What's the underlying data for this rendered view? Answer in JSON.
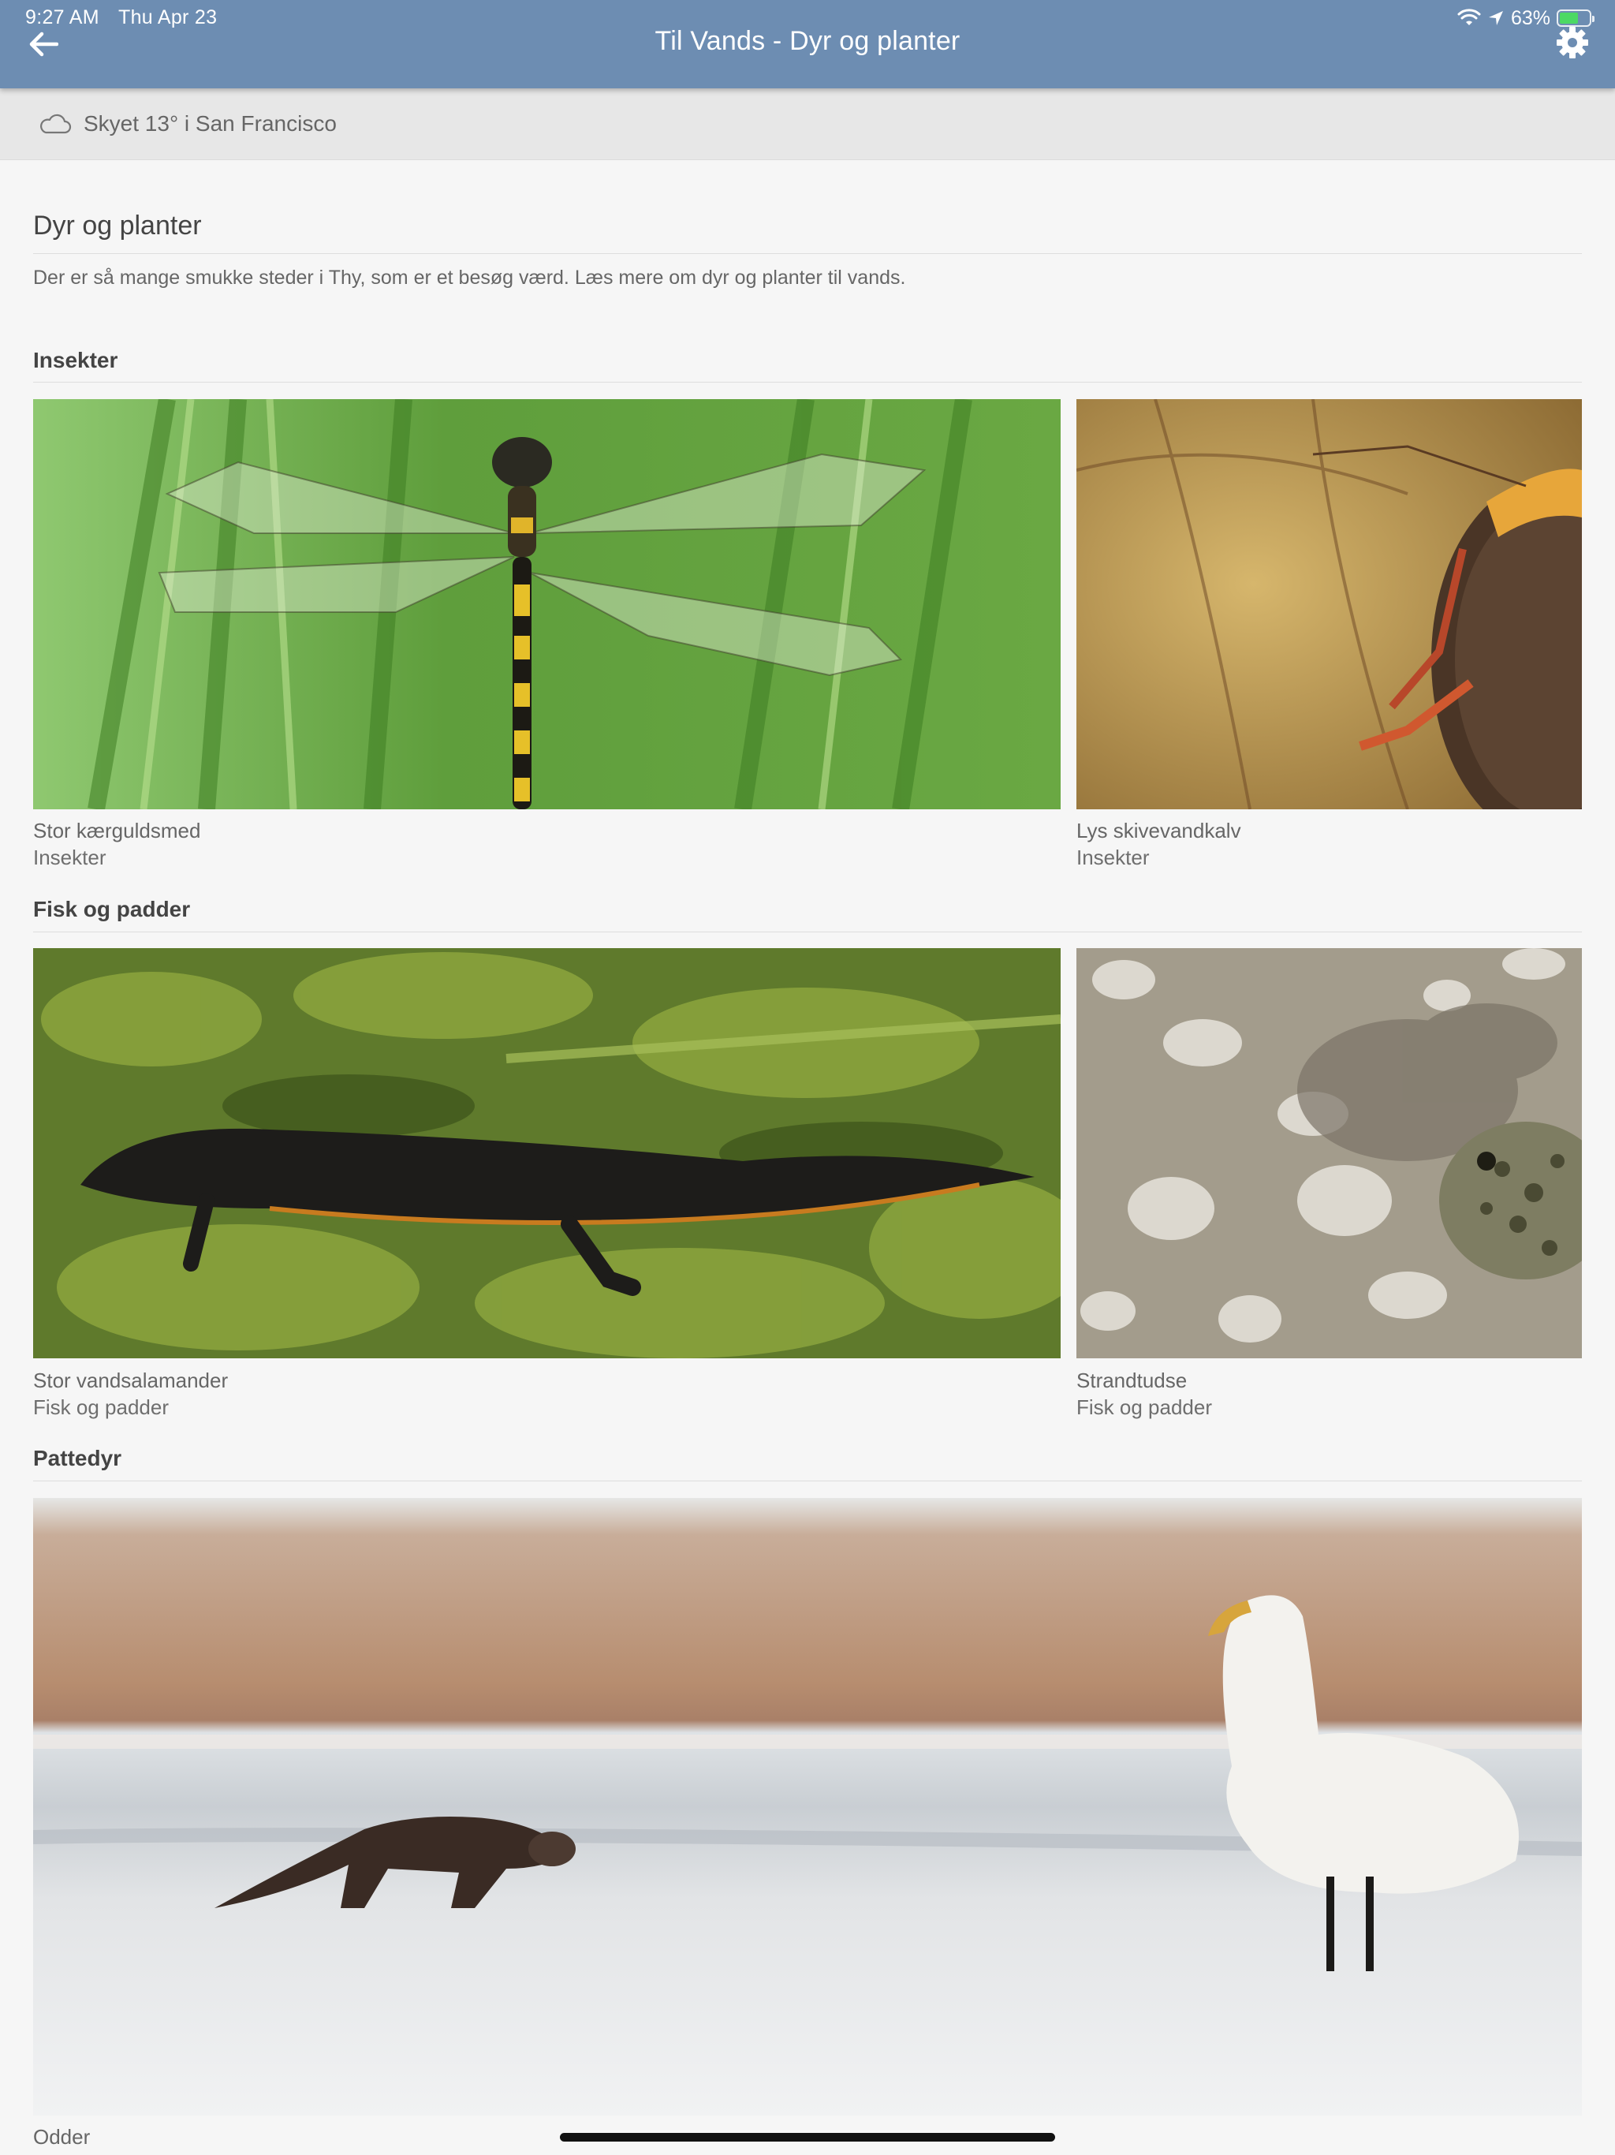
{
  "status_bar": {
    "time": "9:27 AM",
    "date": "Thu Apr 23",
    "battery": "63%",
    "battery_level": 0.63
  },
  "nav": {
    "title": "Til Vands - Dyr og planter",
    "back_icon": "arrow-left-icon",
    "settings_icon": "gear-icon"
  },
  "weather": {
    "icon": "cloud-icon",
    "text": "Skyet 13° i San Francisco"
  },
  "page": {
    "heading": "Dyr og planter",
    "intro": "Der er så mange smukke steder i Thy, som er et besøg værd. Læs mere om dyr og planter til vands."
  },
  "sections": [
    {
      "title": "Insekter",
      "items": [
        {
          "name": "Stor kærguldsmed",
          "category": "Insekter"
        },
        {
          "name": "Lys skivevandkalv",
          "category": "Insekter"
        }
      ]
    },
    {
      "title": "Fisk og padder",
      "items": [
        {
          "name": "Stor vandsalamander",
          "category": "Fisk og padder"
        },
        {
          "name": "Strandtudse",
          "category": "Fisk og padder"
        }
      ]
    },
    {
      "title": "Pattedyr",
      "items": [
        {
          "name": "Odder"
        }
      ]
    }
  ],
  "colors": {
    "accent": "#6d8db2",
    "background": "#f6f6f6",
    "weather_strip": "#e7e7e7"
  }
}
